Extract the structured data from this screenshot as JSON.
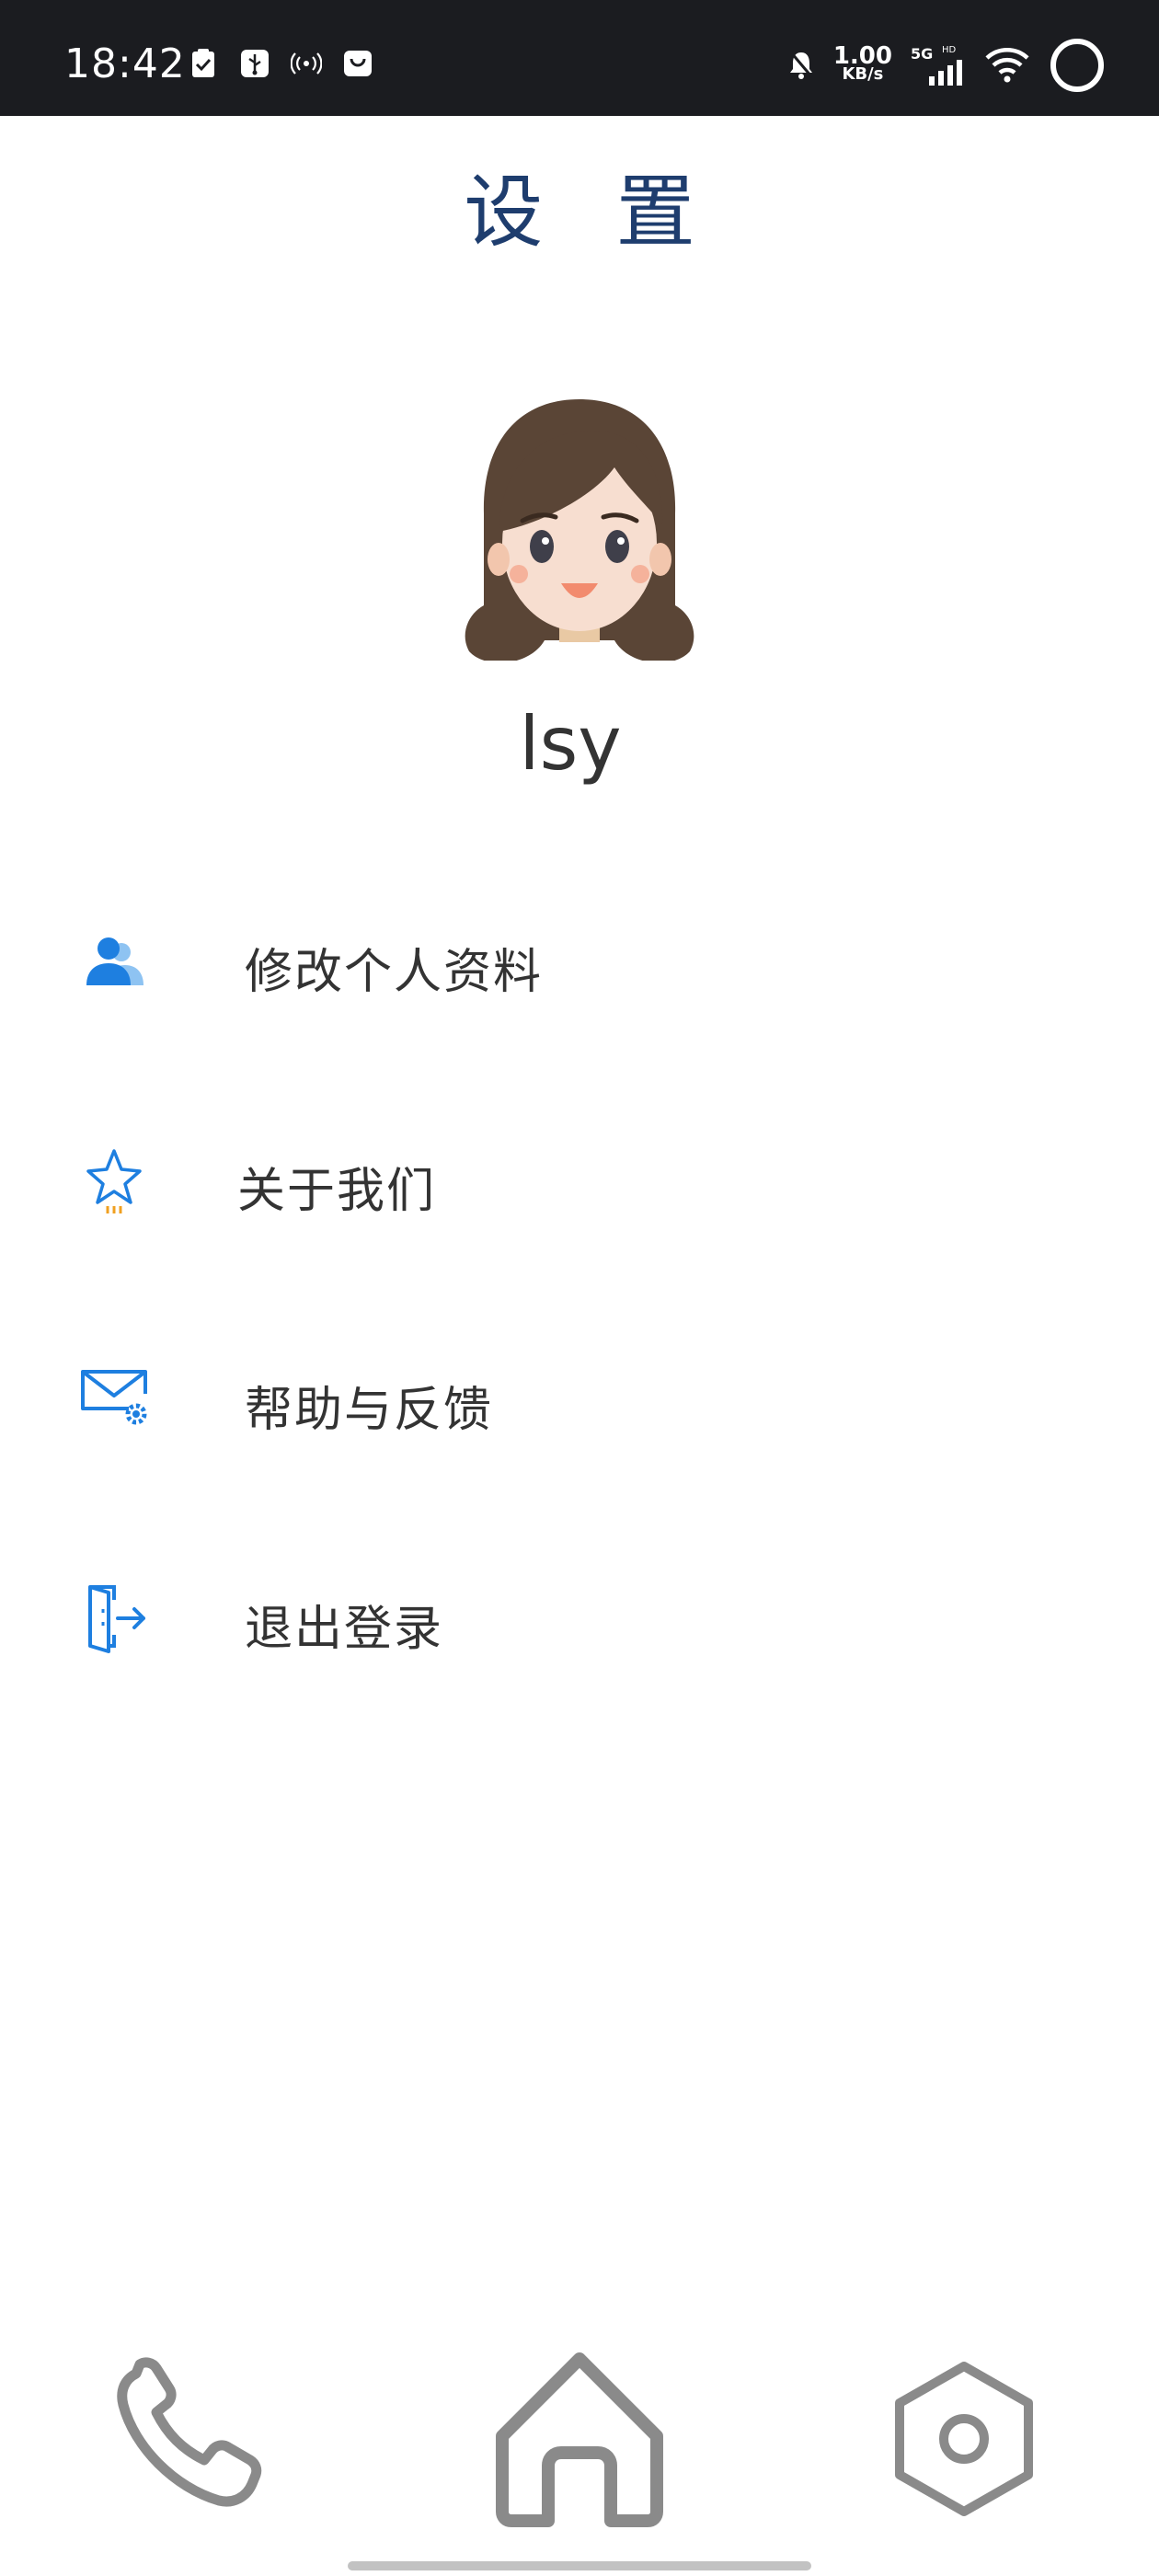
{
  "status_bar": {
    "time": "18:42",
    "net_speed_value": "1.00",
    "net_speed_unit": "KB/s",
    "network_type": "5G",
    "hd_badge": "HD",
    "icons": [
      "clipboard-check-icon",
      "usb-icon",
      "hotspot-icon",
      "bag-icon",
      "alarm-off-icon",
      "signal-icon",
      "wifi-icon",
      "circle-icon"
    ]
  },
  "page": {
    "title": "设 置"
  },
  "profile": {
    "username": "lsy",
    "avatar_icon": "cartoon-girl-avatar-icon"
  },
  "menu": {
    "items": [
      {
        "label": "修改个人资料",
        "icon": "user-group-icon"
      },
      {
        "label": "关于我们",
        "icon": "star-icon"
      },
      {
        "label": "帮助与反馈",
        "icon": "mail-settings-icon"
      },
      {
        "label": "退出登录",
        "icon": "logout-door-icon"
      }
    ]
  },
  "bottom_nav": {
    "items": [
      {
        "icon": "phone-icon"
      },
      {
        "icon": "home-icon"
      },
      {
        "icon": "settings-hexagon-icon"
      }
    ]
  },
  "colors": {
    "status_bg": "#1b1c20",
    "title": "#1e3d6e",
    "accent_blue": "#1e7fe0",
    "nav_gray": "#8a8a8a",
    "text": "#333333"
  }
}
